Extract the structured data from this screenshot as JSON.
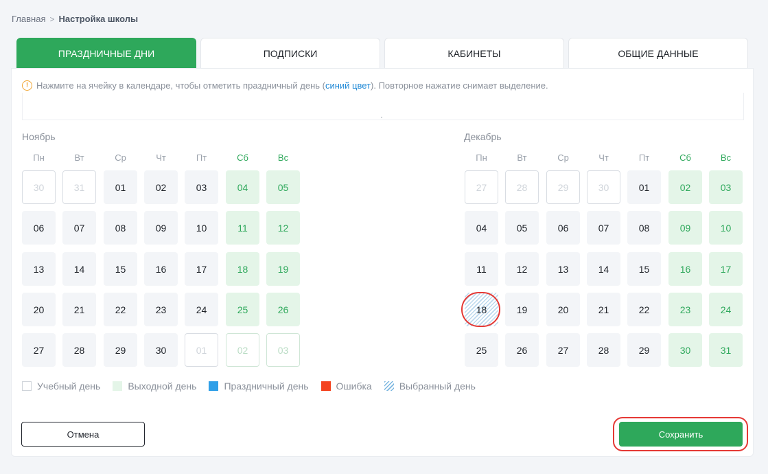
{
  "breadcrumb": {
    "home": "Главная",
    "separator": ">",
    "current": "Настройка школы"
  },
  "tabs": [
    {
      "label": "ПРАЗДНИЧНЫЕ ДНИ",
      "active": true
    },
    {
      "label": "ПОДПИСКИ",
      "active": false
    },
    {
      "label": "КАБИНЕТЫ",
      "active": false
    },
    {
      "label": "ОБЩИЕ ДАННЫЕ",
      "active": false
    }
  ],
  "hint": {
    "icon": "warning-icon",
    "text_before": "Нажмите на ячейку в календаре, чтобы отметить праздничный день (",
    "link_text": "синий цвет",
    "text_after": "). Повторное нажатие снимает выделение."
  },
  "weekdays": [
    "Пн",
    "Вт",
    "Ср",
    "Чт",
    "Пт",
    "Сб",
    "Вс"
  ],
  "months": [
    {
      "title": "Ноябрь",
      "weeks": [
        [
          {
            "d": "30",
            "t": "other"
          },
          {
            "d": "31",
            "t": "other"
          },
          {
            "d": "01",
            "t": "study"
          },
          {
            "d": "02",
            "t": "study"
          },
          {
            "d": "03",
            "t": "study"
          },
          {
            "d": "04",
            "t": "weekend"
          },
          {
            "d": "05",
            "t": "weekend"
          }
        ],
        [
          {
            "d": "06",
            "t": "study"
          },
          {
            "d": "07",
            "t": "study"
          },
          {
            "d": "08",
            "t": "study"
          },
          {
            "d": "09",
            "t": "study"
          },
          {
            "d": "10",
            "t": "study"
          },
          {
            "d": "11",
            "t": "weekend"
          },
          {
            "d": "12",
            "t": "weekend"
          }
        ],
        [
          {
            "d": "13",
            "t": "study"
          },
          {
            "d": "14",
            "t": "study"
          },
          {
            "d": "15",
            "t": "study"
          },
          {
            "d": "16",
            "t": "study"
          },
          {
            "d": "17",
            "t": "study"
          },
          {
            "d": "18",
            "t": "weekend"
          },
          {
            "d": "19",
            "t": "weekend"
          }
        ],
        [
          {
            "d": "20",
            "t": "study"
          },
          {
            "d": "21",
            "t": "study"
          },
          {
            "d": "22",
            "t": "study"
          },
          {
            "d": "23",
            "t": "study"
          },
          {
            "d": "24",
            "t": "study"
          },
          {
            "d": "25",
            "t": "weekend"
          },
          {
            "d": "26",
            "t": "weekend"
          }
        ],
        [
          {
            "d": "27",
            "t": "study"
          },
          {
            "d": "28",
            "t": "study"
          },
          {
            "d": "29",
            "t": "study"
          },
          {
            "d": "30",
            "t": "study"
          },
          {
            "d": "01",
            "t": "other"
          },
          {
            "d": "02",
            "t": "other-weekend"
          },
          {
            "d": "03",
            "t": "other-weekend"
          }
        ]
      ]
    },
    {
      "title": "Декабрь",
      "weeks": [
        [
          {
            "d": "27",
            "t": "other"
          },
          {
            "d": "28",
            "t": "other"
          },
          {
            "d": "29",
            "t": "other"
          },
          {
            "d": "30",
            "t": "other"
          },
          {
            "d": "01",
            "t": "study"
          },
          {
            "d": "02",
            "t": "weekend"
          },
          {
            "d": "03",
            "t": "weekend"
          }
        ],
        [
          {
            "d": "04",
            "t": "study"
          },
          {
            "d": "05",
            "t": "study"
          },
          {
            "d": "06",
            "t": "study"
          },
          {
            "d": "07",
            "t": "study"
          },
          {
            "d": "08",
            "t": "study"
          },
          {
            "d": "09",
            "t": "weekend"
          },
          {
            "d": "10",
            "t": "weekend"
          }
        ],
        [
          {
            "d": "11",
            "t": "study"
          },
          {
            "d": "12",
            "t": "study"
          },
          {
            "d": "13",
            "t": "study"
          },
          {
            "d": "14",
            "t": "study"
          },
          {
            "d": "15",
            "t": "study"
          },
          {
            "d": "16",
            "t": "weekend"
          },
          {
            "d": "17",
            "t": "weekend"
          }
        ],
        [
          {
            "d": "18",
            "t": "selected"
          },
          {
            "d": "19",
            "t": "study"
          },
          {
            "d": "20",
            "t": "study"
          },
          {
            "d": "21",
            "t": "study"
          },
          {
            "d": "22",
            "t": "study"
          },
          {
            "d": "23",
            "t": "weekend"
          },
          {
            "d": "24",
            "t": "weekend"
          }
        ],
        [
          {
            "d": "25",
            "t": "study"
          },
          {
            "d": "26",
            "t": "study"
          },
          {
            "d": "27",
            "t": "study"
          },
          {
            "d": "28",
            "t": "study"
          },
          {
            "d": "29",
            "t": "study"
          },
          {
            "d": "30",
            "t": "weekend"
          },
          {
            "d": "31",
            "t": "weekend"
          }
        ]
      ]
    }
  ],
  "legend": [
    {
      "label": "Учебный день",
      "kind": "study"
    },
    {
      "label": "Выходной день",
      "kind": "weekend"
    },
    {
      "label": "Праздничный день",
      "kind": "holiday"
    },
    {
      "label": "Ошибка",
      "kind": "error"
    },
    {
      "label": "Выбранный день",
      "kind": "selected"
    }
  ],
  "buttons": {
    "cancel": "Отмена",
    "save": "Сохранить"
  },
  "colors": {
    "accent": "#2ea85b",
    "holiday": "#2f9fe8",
    "error": "#f4431f",
    "highlight_ring": "#e53935"
  }
}
